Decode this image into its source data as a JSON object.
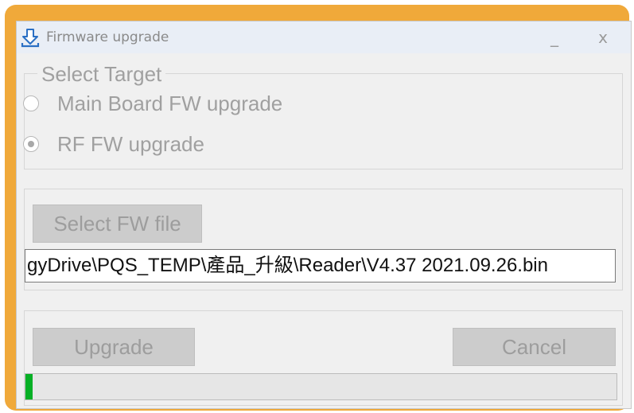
{
  "window": {
    "title": "Firmware upgrade",
    "minimize_glyph": "_",
    "close_glyph": "x",
    "app_icon": "download-arrow-icon"
  },
  "select_target": {
    "legend": "Select Target",
    "options": [
      {
        "label": "Main Board FW upgrade",
        "selected": false
      },
      {
        "label": "RF FW upgrade",
        "selected": true
      }
    ]
  },
  "file": {
    "select_button": "Select FW file",
    "path_value": "gyDrive\\PQS_TEMP\\產品_升級\\Reader\\V4.37 2021.09.26.bin"
  },
  "actions": {
    "upgrade_button": "Upgrade",
    "cancel_button": "Cancel",
    "progress_fraction": 0.012,
    "progress_color": "#06b025"
  },
  "colors": {
    "frame_accent": "#f0a93a",
    "disabled_text": "#a0a0a0"
  }
}
